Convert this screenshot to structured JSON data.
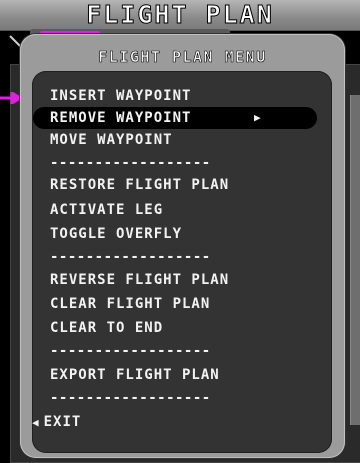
{
  "header": {
    "title": "FLIGHT PLAN"
  },
  "colors": {
    "accent": "#e020e0",
    "menu_frame": "#9b9b9b",
    "menu_body": "#333333",
    "selection": "#000000",
    "text": "#f2f2f2"
  },
  "menu": {
    "title": "FLIGHT PLAN MENU",
    "selected_index": 1,
    "items": [
      {
        "label": "INSERT WAYPOINT"
      },
      {
        "label": "REMOVE WAYPOINT",
        "submenu_icon": "play-triangle-icon"
      },
      {
        "label": "MOVE WAYPOINT"
      },
      {
        "label": "------------------"
      },
      {
        "label": "RESTORE FLIGHT PLAN"
      },
      {
        "label": "ACTIVATE LEG"
      },
      {
        "label": "TOGGLE OVERFLY"
      },
      {
        "label": "------------------"
      },
      {
        "label": "REVERSE FLIGHT PLAN"
      },
      {
        "label": "CLEAR FLIGHT PLAN"
      },
      {
        "label": "CLEAR TO END"
      },
      {
        "label": "------------------"
      },
      {
        "label": "EXPORT FLIGHT PLAN"
      },
      {
        "label": "------------------"
      },
      {
        "label": "EXIT",
        "icon": "left-triangle-icon"
      }
    ]
  }
}
